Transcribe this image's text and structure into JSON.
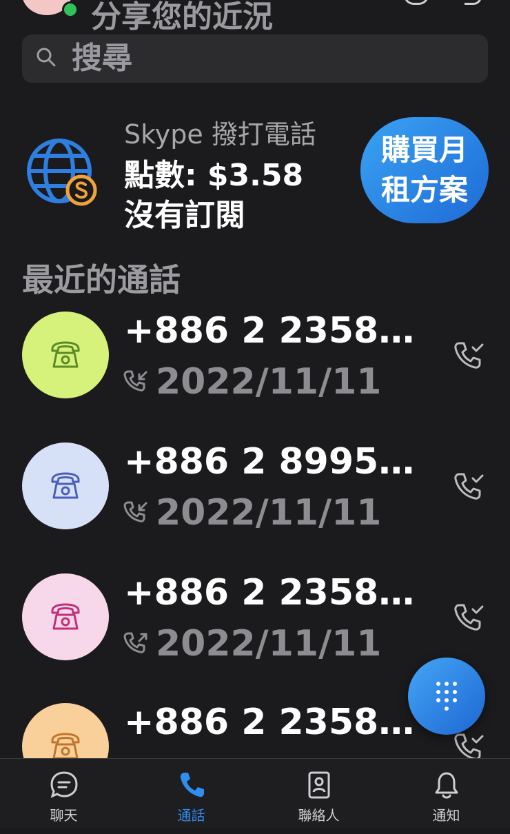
{
  "header": {
    "status_text": "分享您的近況"
  },
  "search": {
    "placeholder": "搜尋"
  },
  "skype_credit": {
    "title": "Skype 撥打電話",
    "credit": "點數: $3.58",
    "subscription": "沒有訂閱",
    "buy_button": "購買月租方案"
  },
  "recent_calls": {
    "title": "最近的通話",
    "items": [
      {
        "number": "+886 2 2358…",
        "date": "2022/11/11",
        "direction": "incoming",
        "avatar_color": "#d7f27a",
        "icon_color": "#5a8a2a"
      },
      {
        "number": "+886 2 8995…",
        "date": "2022/11/11",
        "direction": "incoming",
        "avatar_color": "#d6e0f6",
        "icon_color": "#4a5ec0"
      },
      {
        "number": "+886 2 2358…",
        "date": "2022/11/11",
        "direction": "outgoing",
        "avatar_color": "#f7d7ea",
        "icon_color": "#c0307a"
      },
      {
        "number": "+886 2 2358…",
        "date": "",
        "direction": "",
        "avatar_color": "#f9cf9a",
        "icon_color": "#c0762a"
      }
    ]
  },
  "nav": {
    "items": [
      {
        "label": "聊天",
        "icon": "chat-icon",
        "active": false
      },
      {
        "label": "通話",
        "icon": "phone-icon",
        "active": true
      },
      {
        "label": "聯絡人",
        "icon": "contacts-icon",
        "active": false
      },
      {
        "label": "通知",
        "icon": "bell-icon",
        "active": false
      }
    ]
  },
  "colors": {
    "accent": "#2f8ef0",
    "background": "#1b1b1d"
  }
}
